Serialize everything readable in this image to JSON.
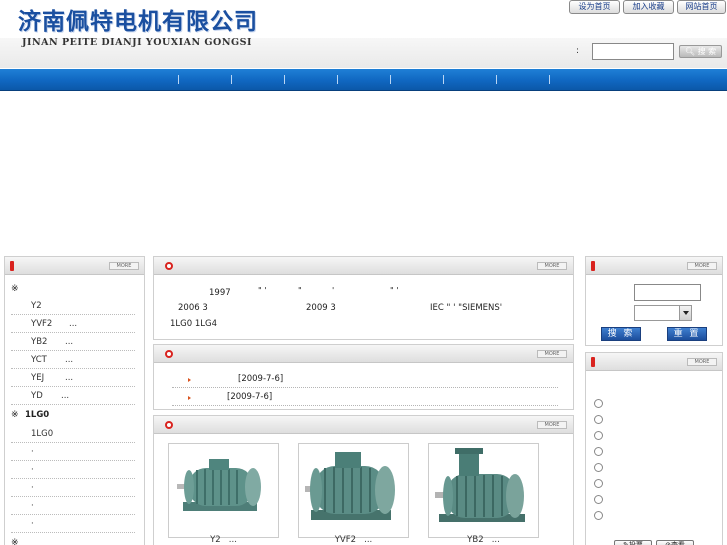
{
  "header": {
    "company_cn": "济南佩特电机有限公司",
    "company_en": "JINAN PEITE DIANJI YOUXIAN GONGSI",
    "top_links": [
      "设为首页",
      "加入收藏",
      "网站首页"
    ],
    "search_colon": ":",
    "search_value": "",
    "search_button": "搜 索"
  },
  "left_panel": {
    "more": "MORE",
    "section1_mark": "※",
    "items": [
      {
        "a": "Y2",
        "b": ""
      },
      {
        "a": "YVF2",
        "b": "..."
      },
      {
        "a": "YB2",
        "b": "..."
      },
      {
        "a": "YCT",
        "b": "..."
      },
      {
        "a": "YEJ",
        "b": "..."
      },
      {
        "a": "YD",
        "b": "..."
      }
    ],
    "section2_mark": "※",
    "section2_title": "1LG0",
    "items2": [
      "1LG0",
      "·",
      "·",
      "·",
      "·",
      "·"
    ],
    "section3_mark": "※"
  },
  "center": {
    "intro_more": "MORE",
    "intro_line1": [
      "1997",
      "\" '",
      "\"",
      "'",
      "\" '"
    ],
    "intro_line2": [
      "2006 3",
      "2009 3",
      "IEC  \" '  \"SIEMENS'"
    ],
    "intro_line3": "1LG0 1LG4",
    "news_more": "MORE",
    "news": [
      {
        "date": "[2009-7-6]"
      },
      {
        "date": "[2009-7-6]"
      }
    ],
    "products_more": "MORE",
    "products": [
      {
        "name": "Y2",
        "suffix": "..."
      },
      {
        "name": "YVF2",
        "suffix": "..."
      },
      {
        "name": "YB2",
        "suffix": "..."
      }
    ]
  },
  "right_panel": {
    "more1": "MORE",
    "search_value": "",
    "select_value": "",
    "search_button": "搜 索",
    "reset_button": "重 置",
    "more2": "MORE",
    "vote_options_count": 8,
    "vote_button": "投票",
    "view_button": "查看"
  },
  "colors": {
    "nav_blue": "#1067c1",
    "brand_blue": "#1a4fa0",
    "accent_red": "#d9231f"
  }
}
